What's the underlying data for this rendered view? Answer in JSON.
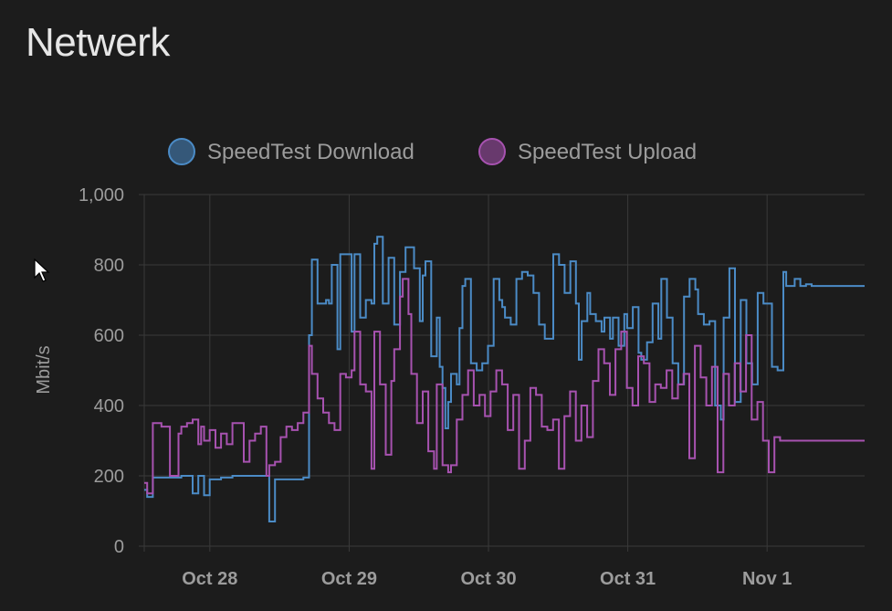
{
  "card": {
    "title": "Netwerk"
  },
  "colors": {
    "download": "#4b8bc6",
    "upload": "#a752b0",
    "grid": "#3a3a3a",
    "text": "#9c9c9c",
    "background": "#1c1c1c"
  },
  "icons": {
    "cursor": "mouse-pointer-icon"
  },
  "chart_data": {
    "type": "line",
    "step": true,
    "ylabel": "Mbit/s",
    "ylim": [
      0,
      1000
    ],
    "yticks": [
      "0",
      "200",
      "400",
      "600",
      "800",
      "1,000"
    ],
    "xlim": [
      "Oct 27 12:42",
      "Nov 1 16:48"
    ],
    "xticks": [
      {
        "label": "Oct 28",
        "time": "Oct 28 00:00"
      },
      {
        "label": "Oct 29",
        "time": "Oct 29 00:00"
      },
      {
        "label": "Oct 30",
        "time": "Oct 30 00:00"
      },
      {
        "label": "Oct 31",
        "time": "Oct 31 00:00"
      },
      {
        "label": "Nov 1",
        "time": "Nov 1 00:00"
      }
    ],
    "grid": true,
    "legend_position": "top-center",
    "series": [
      {
        "name": "SpeedTest Download",
        "color": "#4b8bc6",
        "points": [
          [
            "Oct 27 12:42",
            160
          ],
          [
            "Oct 27 13:12",
            140
          ],
          [
            "Oct 27 14:11",
            195
          ],
          [
            "Oct 27 19:05",
            200
          ],
          [
            "Oct 27 21:02",
            150
          ],
          [
            "Oct 27 22:01",
            200
          ],
          [
            "Oct 27 23:00",
            145
          ],
          [
            "Oct 27 23:59",
            190
          ],
          [
            "Oct 28 01:56",
            195
          ],
          [
            "Oct 28 03:54",
            200
          ],
          [
            "Oct 28 09:45",
            200
          ],
          [
            "Oct 28 10:14",
            70
          ],
          [
            "Oct 28 11:13",
            190
          ],
          [
            "Oct 28 16:07",
            195
          ],
          [
            "Oct 28 17:05",
            600
          ],
          [
            "Oct 28 17:35",
            815
          ],
          [
            "Oct 28 18:33",
            690
          ],
          [
            "Oct 28 20:01",
            700
          ],
          [
            "Oct 28 20:31",
            690
          ],
          [
            "Oct 28 21:00",
            800
          ],
          [
            "Oct 28 21:59",
            560
          ],
          [
            "Oct 28 22:28",
            830
          ],
          [
            "Oct 29 00:25",
            610
          ],
          [
            "Oct 29 00:55",
            830
          ],
          [
            "Oct 29 01:54",
            650
          ],
          [
            "Oct 29 02:52",
            700
          ],
          [
            "Oct 29 03:51",
            690
          ],
          [
            "Oct 29 04:20",
            860
          ],
          [
            "Oct 29 04:50",
            880
          ],
          [
            "Oct 29 05:48",
            690
          ],
          [
            "Oct 29 06:47",
            820
          ],
          [
            "Oct 29 07:46",
            630
          ],
          [
            "Oct 29 08:45",
            780
          ],
          [
            "Oct 29 09:43",
            850
          ],
          [
            "Oct 29 11:11",
            790
          ],
          [
            "Oct 29 12:10",
            640
          ],
          [
            "Oct 29 12:40",
            770
          ],
          [
            "Oct 29 13:09",
            810
          ],
          [
            "Oct 29 14:08",
            540
          ],
          [
            "Oct 29 15:06",
            650
          ],
          [
            "Oct 29 15:36",
            510
          ],
          [
            "Oct 29 16:05",
            450
          ],
          [
            "Oct 29 16:34",
            335
          ],
          [
            "Oct 29 17:04",
            410
          ],
          [
            "Oct 29 17:33",
            490
          ],
          [
            "Oct 29 18:32",
            460
          ],
          [
            "Oct 29 19:01",
            620
          ],
          [
            "Oct 29 19:31",
            740
          ],
          [
            "Oct 29 20:00",
            760
          ],
          [
            "Oct 29 20:59",
            520
          ],
          [
            "Oct 29 21:58",
            500
          ],
          [
            "Oct 29 22:56",
            520
          ],
          [
            "Oct 29 23:55",
            570
          ],
          [
            "Oct 30 00:54",
            760
          ],
          [
            "Oct 30 01:52",
            700
          ],
          [
            "Oct 30 02:22",
            680
          ],
          [
            "Oct 30 02:51",
            650
          ],
          [
            "Oct 30 03:50",
            630
          ],
          [
            "Oct 30 04:49",
            760
          ],
          [
            "Oct 30 05:47",
            780
          ],
          [
            "Oct 30 06:46",
            770
          ],
          [
            "Oct 30 07:45",
            720
          ],
          [
            "Oct 30 08:43",
            630
          ],
          [
            "Oct 30 09:42",
            590
          ],
          [
            "Oct 30 11:10",
            830
          ],
          [
            "Oct 30 12:09",
            800
          ],
          [
            "Oct 30 13:07",
            720
          ],
          [
            "Oct 30 14:06",
            810
          ],
          [
            "Oct 30 15:04",
            690
          ],
          [
            "Oct 30 15:34",
            530
          ],
          [
            "Oct 30 16:03",
            640
          ],
          [
            "Oct 30 17:02",
            720
          ],
          [
            "Oct 30 17:31",
            660
          ],
          [
            "Oct 30 18:30",
            640
          ],
          [
            "Oct 30 19:29",
            610
          ],
          [
            "Oct 30 19:58",
            650
          ],
          [
            "Oct 30 20:57",
            590
          ],
          [
            "Oct 30 21:26",
            650
          ],
          [
            "Oct 30 22:25",
            570
          ],
          [
            "Oct 30 23:24",
            660
          ],
          [
            "Oct 30 23:53",
            620
          ],
          [
            "Oct 31 00:52",
            680
          ],
          [
            "Oct 31 01:51",
            550
          ],
          [
            "Oct 31 02:20",
            530
          ],
          [
            "Oct 31 03:19",
            580
          ],
          [
            "Oct 31 04:17",
            690
          ],
          [
            "Oct 31 05:16",
            590
          ],
          [
            "Oct 31 05:46",
            760
          ],
          [
            "Oct 31 06:45",
            650
          ],
          [
            "Oct 31 07:43",
            520
          ],
          [
            "Oct 31 08:42",
            460
          ],
          [
            "Oct 31 09:41",
            710
          ],
          [
            "Oct 31 10:39",
            760
          ],
          [
            "Oct 31 11:38",
            730
          ],
          [
            "Oct 31 12:07",
            660
          ],
          [
            "Oct 31 13:06",
            630
          ],
          [
            "Oct 31 14:05",
            640
          ],
          [
            "Oct 31 15:03",
            400
          ],
          [
            "Oct 31 16:02",
            360
          ],
          [
            "Oct 31 16:31",
            650
          ],
          [
            "Oct 31 17:30",
            790
          ],
          [
            "Oct 31 18:28",
            410
          ],
          [
            "Oct 31 19:27",
            700
          ],
          [
            "Oct 31 20:26",
            520
          ],
          [
            "Oct 31 21:25",
            460
          ],
          [
            "Oct 31 22:23",
            720
          ],
          [
            "Oct 31 23:22",
            690
          ],
          [
            "Nov 1 00:50",
            510
          ],
          [
            "Nov 1 01:49",
            500
          ],
          [
            "Nov 1 02:48",
            780
          ],
          [
            "Nov 1 03:17",
            740
          ],
          [
            "Nov 1 03:46",
            740
          ],
          [
            "Nov 1 04:45",
            760
          ],
          [
            "Nov 1 05:44",
            740
          ],
          [
            "Nov 1 06:42",
            745
          ],
          [
            "Nov 1 07:41",
            740
          ],
          [
            "Nov 1 08:40",
            740
          ],
          [
            "Nov 1 16:48",
            740
          ]
        ]
      },
      {
        "name": "SpeedTest Upload",
        "color": "#a752b0",
        "points": [
          [
            "Oct 27 12:42",
            180
          ],
          [
            "Oct 27 13:12",
            150
          ],
          [
            "Oct 27 14:11",
            350
          ],
          [
            "Oct 27 15:39",
            340
          ],
          [
            "Oct 27 17:07",
            200
          ],
          [
            "Oct 27 18:36",
            320
          ],
          [
            "Oct 27 19:05",
            340
          ],
          [
            "Oct 27 20:04",
            350
          ],
          [
            "Oct 27 21:02",
            360
          ],
          [
            "Oct 27 22:01",
            290
          ],
          [
            "Oct 27 22:30",
            340
          ],
          [
            "Oct 27 23:00",
            300
          ],
          [
            "Oct 27 23:59",
            330
          ],
          [
            "Oct 28 00:58",
            280
          ],
          [
            "Oct 28 01:56",
            320
          ],
          [
            "Oct 28 02:55",
            290
          ],
          [
            "Oct 28 03:54",
            350
          ],
          [
            "Oct 28 05:51",
            240
          ],
          [
            "Oct 28 06:50",
            300
          ],
          [
            "Oct 28 07:48",
            320
          ],
          [
            "Oct 28 08:47",
            340
          ],
          [
            "Oct 28 09:45",
            200
          ],
          [
            "Oct 28 10:14",
            230
          ],
          [
            "Oct 28 11:13",
            240
          ],
          [
            "Oct 28 12:12",
            310
          ],
          [
            "Oct 28 13:11",
            340
          ],
          [
            "Oct 28 14:09",
            330
          ],
          [
            "Oct 28 15:08",
            350
          ],
          [
            "Oct 28 16:07",
            380
          ],
          [
            "Oct 28 17:05",
            570
          ],
          [
            "Oct 28 17:35",
            490
          ],
          [
            "Oct 28 18:33",
            420
          ],
          [
            "Oct 28 19:32",
            380
          ],
          [
            "Oct 28 20:31",
            350
          ],
          [
            "Oct 28 21:29",
            330
          ],
          [
            "Oct 28 22:28",
            490
          ],
          [
            "Oct 28 23:27",
            480
          ],
          [
            "Oct 29 00:25",
            500
          ],
          [
            "Oct 29 00:55",
            610
          ],
          [
            "Oct 29 01:54",
            460
          ],
          [
            "Oct 29 02:52",
            440
          ],
          [
            "Oct 29 03:51",
            220
          ],
          [
            "Oct 29 04:20",
            610
          ],
          [
            "Oct 29 05:19",
            460
          ],
          [
            "Oct 29 06:18",
            260
          ],
          [
            "Oct 29 07:16",
            470
          ],
          [
            "Oct 29 07:46",
            560
          ],
          [
            "Oct 29 08:45",
            710
          ],
          [
            "Oct 29 09:14",
            760
          ],
          [
            "Oct 29 10:13",
            660
          ],
          [
            "Oct 29 10:42",
            490
          ],
          [
            "Oct 29 11:41",
            350
          ],
          [
            "Oct 29 12:40",
            440
          ],
          [
            "Oct 29 13:38",
            270
          ],
          [
            "Oct 29 14:37",
            220
          ],
          [
            "Oct 29 15:06",
            460
          ],
          [
            "Oct 29 16:05",
            230
          ],
          [
            "Oct 29 17:04",
            210
          ],
          [
            "Oct 29 17:33",
            230
          ],
          [
            "Oct 29 18:32",
            360
          ],
          [
            "Oct 29 19:31",
            430
          ],
          [
            "Oct 29 20:29",
            500
          ],
          [
            "Oct 29 21:28",
            400
          ],
          [
            "Oct 29 22:27",
            430
          ],
          [
            "Oct 29 23:24",
            370
          ],
          [
            "Oct 30 00:22",
            440
          ],
          [
            "Oct 30 01:21",
            500
          ],
          [
            "Oct 30 02:20",
            460
          ],
          [
            "Oct 30 03:19",
            330
          ],
          [
            "Oct 30 04:17",
            430
          ],
          [
            "Oct 30 05:16",
            220
          ],
          [
            "Oct 30 06:15",
            300
          ],
          [
            "Oct 30 07:13",
            450
          ],
          [
            "Oct 30 08:12",
            430
          ],
          [
            "Oct 30 09:11",
            340
          ],
          [
            "Oct 30 10:09",
            330
          ],
          [
            "Oct 30 11:08",
            360
          ],
          [
            "Oct 30 12:07",
            220
          ],
          [
            "Oct 30 13:05",
            370
          ],
          [
            "Oct 30 14:04",
            440
          ],
          [
            "Oct 30 15:03",
            300
          ],
          [
            "Oct 30 16:01",
            400
          ],
          [
            "Oct 30 17:00",
            310
          ],
          [
            "Oct 30 17:59",
            470
          ],
          [
            "Oct 30 18:57",
            560
          ],
          [
            "Oct 30 19:56",
            520
          ],
          [
            "Oct 30 20:55",
            430
          ],
          [
            "Oct 30 21:53",
            560
          ],
          [
            "Oct 30 22:52",
            610
          ],
          [
            "Oct 30 23:51",
            450
          ],
          [
            "Oct 31 00:49",
            400
          ],
          [
            "Oct 31 01:48",
            540
          ],
          [
            "Oct 31 02:46",
            520
          ],
          [
            "Oct 31 03:45",
            410
          ],
          [
            "Oct 31 04:44",
            460
          ],
          [
            "Oct 31 05:42",
            450
          ],
          [
            "Oct 31 06:41",
            500
          ],
          [
            "Oct 31 07:40",
            420
          ],
          [
            "Oct 31 08:38",
            460
          ],
          [
            "Oct 31 09:37",
            490
          ],
          [
            "Oct 31 10:36",
            250
          ],
          [
            "Oct 31 11:34",
            570
          ],
          [
            "Oct 31 12:33",
            480
          ],
          [
            "Oct 31 13:32",
            400
          ],
          [
            "Oct 31 14:30",
            510
          ],
          [
            "Oct 31 15:29",
            210
          ],
          [
            "Oct 31 16:28",
            490
          ],
          [
            "Oct 31 17:26",
            400
          ],
          [
            "Oct 31 18:25",
            520
          ],
          [
            "Oct 31 19:24",
            440
          ],
          [
            "Oct 31 20:22",
            600
          ],
          [
            "Oct 31 21:21",
            360
          ],
          [
            "Oct 31 22:20",
            410
          ],
          [
            "Oct 31 23:18",
            300
          ],
          [
            "Nov 1 00:17",
            210
          ],
          [
            "Nov 1 01:16",
            310
          ],
          [
            "Nov 1 02:14",
            300
          ],
          [
            "Nov 1 16:48",
            300
          ]
        ]
      }
    ]
  }
}
